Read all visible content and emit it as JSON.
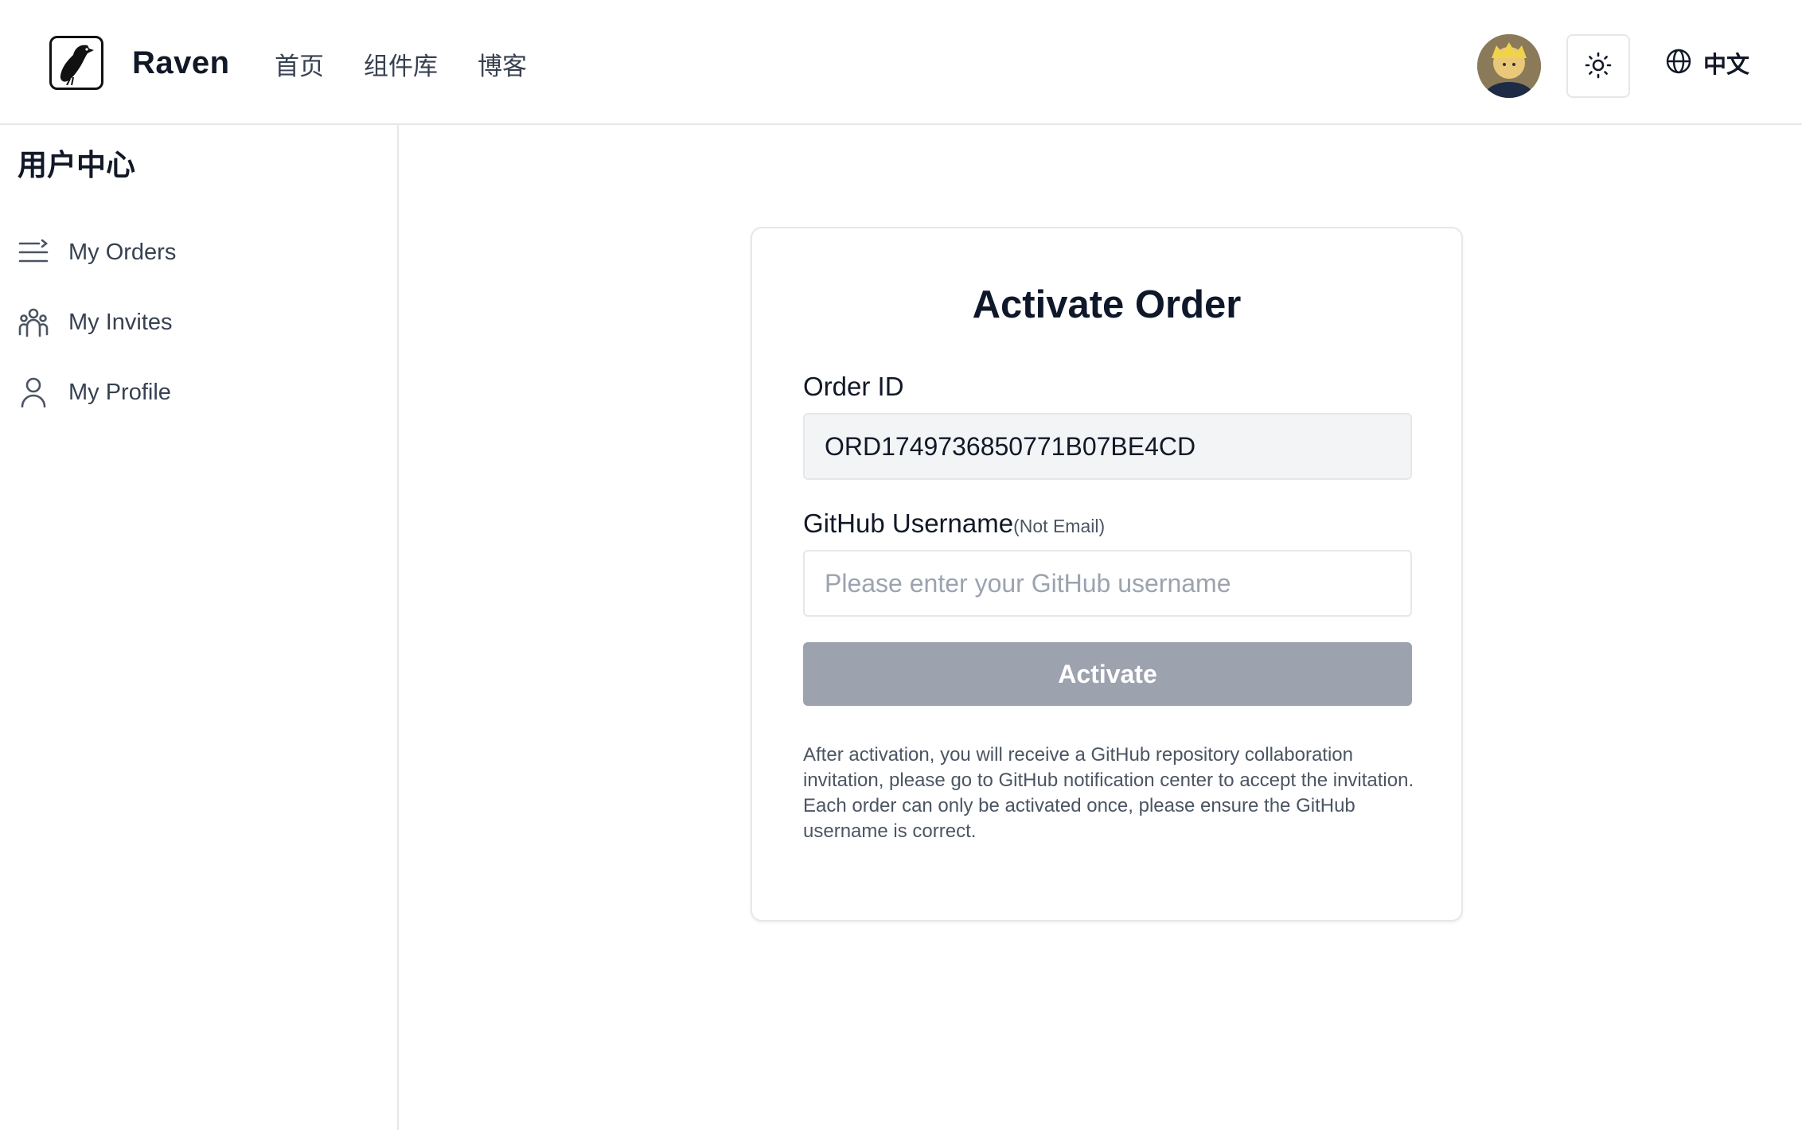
{
  "header": {
    "brand_name": "Raven",
    "nav": [
      "首页",
      "组件库",
      "博客"
    ],
    "language_label": "中文"
  },
  "sidebar": {
    "title": "用户中心",
    "items": [
      {
        "label": "My Orders",
        "icon": "list-icon"
      },
      {
        "label": "My Invites",
        "icon": "users-icon"
      },
      {
        "label": "My Profile",
        "icon": "user-icon"
      }
    ]
  },
  "card": {
    "title": "Activate Order",
    "order_id_label": "Order ID",
    "order_id_value": "ORD1749736850771B07BE4CD",
    "github_label": "GitHub Username",
    "github_sub_label": "(Not Email)",
    "github_placeholder": "Please enter your GitHub username",
    "github_value": "",
    "activate_label": "Activate",
    "note_line1": "After activation, you will receive a GitHub repository collaboration invitation, please go to GitHub notification center to accept the invitation.",
    "note_line2": "Each order can only be activated once, please ensure the GitHub username is correct."
  },
  "colors": {
    "button_disabled": "#9ca3af",
    "border": "#e5e7eb",
    "readonly_bg": "#f3f4f6"
  }
}
